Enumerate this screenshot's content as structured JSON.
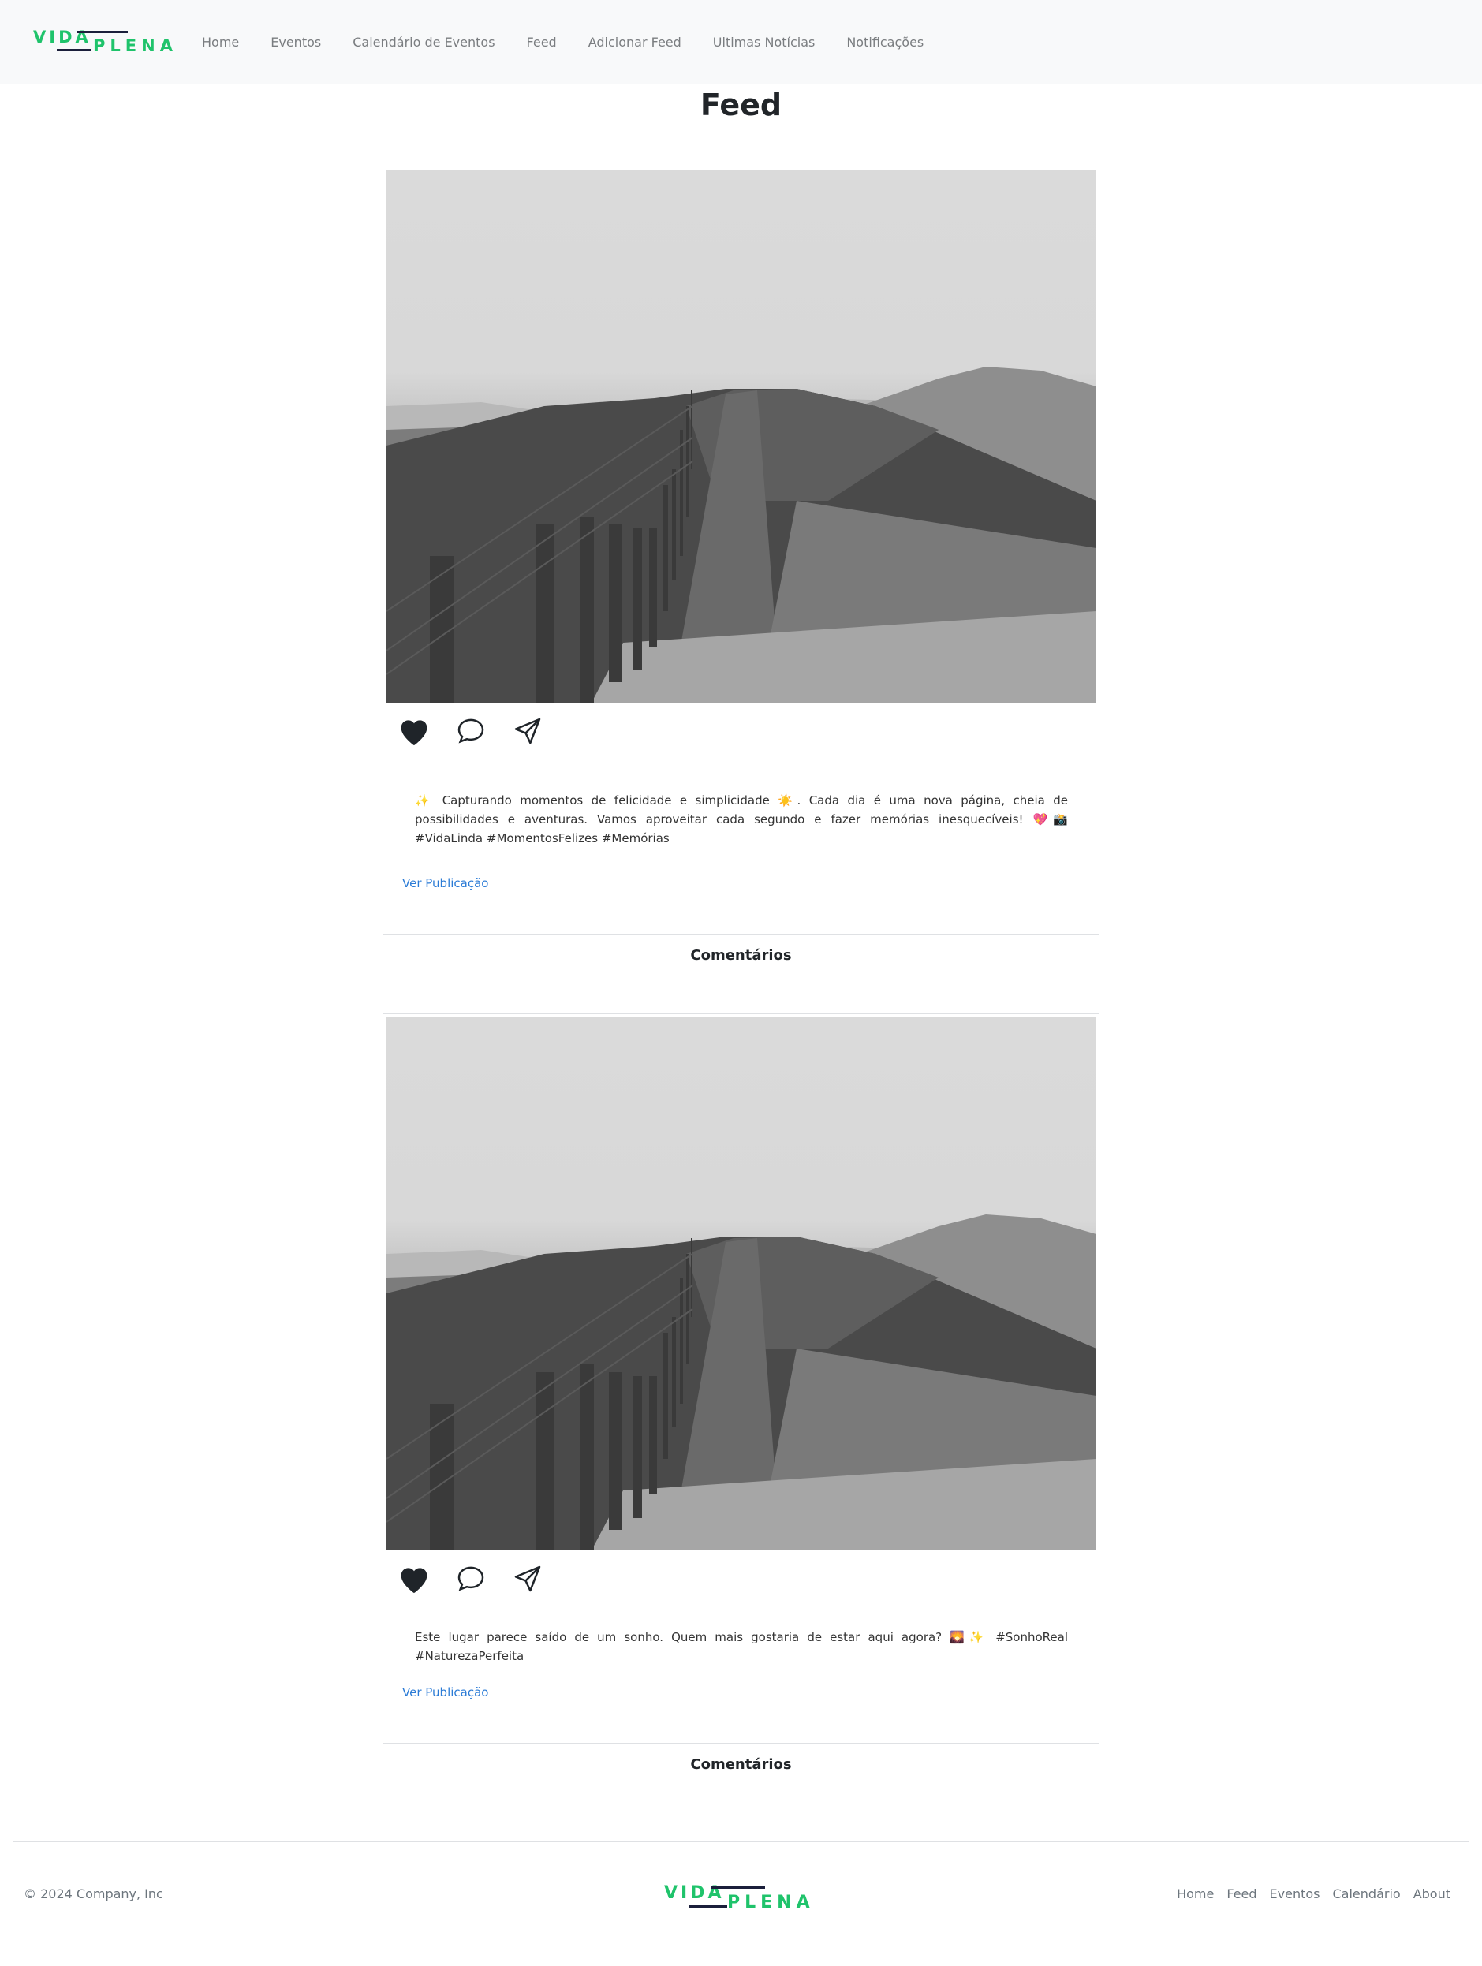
{
  "brand": {
    "word1": "VIDA",
    "word2": "PLENA",
    "green": "#1fc36b",
    "navy": "#1b1f3b"
  },
  "nav": {
    "items": [
      "Home",
      "Eventos",
      "Calendário de Eventos",
      "Feed",
      "Adicionar Feed",
      "Ultimas Notícias",
      "Notificações"
    ]
  },
  "page": {
    "title": "Feed"
  },
  "posts": [
    {
      "image": "landscape-photo",
      "caption": "✨ Capturando momentos de felicidade e simplicidade ☀️. Cada dia é uma nova página, cheia de possibilidades e aventuras. Vamos aproveitar cada segundo e fazer memórias inesquecíveis! 💖📸 #VidaLinda #MomentosFelizes #Memórias",
      "view_label": "Ver Publicação",
      "comments_label": "Comentários"
    },
    {
      "image": "landscape-photo",
      "caption": "Este lugar parece saído de um sonho. Quem mais gostaria de estar aqui agora? 🌄✨ #SonhoReal #NaturezaPerfeita",
      "view_label": "Ver Publicação",
      "comments_label": "Comentários"
    }
  ],
  "icons": {
    "like": "heart-icon",
    "comment": "comment-bubble-icon",
    "share": "send-icon"
  },
  "footer": {
    "copyright": "© 2024 Company, Inc",
    "links": [
      "Home",
      "Feed",
      "Eventos",
      "Calendário",
      "About"
    ]
  }
}
